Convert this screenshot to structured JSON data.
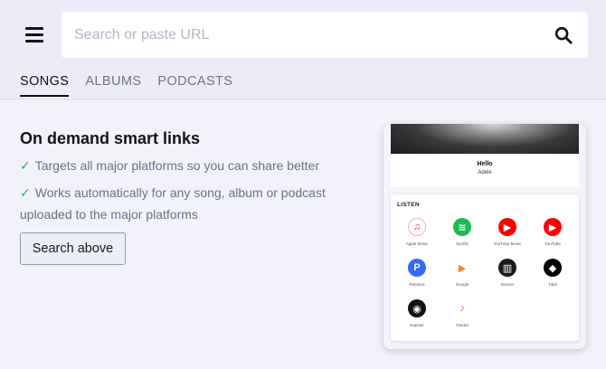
{
  "header": {
    "menu_icon": "hamburger-menu-icon",
    "search": {
      "placeholder": "Search or paste URL",
      "value": "",
      "icon": "search-icon"
    },
    "tabs": [
      {
        "label": "SONGS",
        "active": true
      },
      {
        "label": "ALBUMS",
        "active": false
      },
      {
        "label": "PODCASTS",
        "active": false
      }
    ]
  },
  "main": {
    "headline": "On demand smart links",
    "features": [
      "Targets all major platforms so you can share better",
      "Works automatically for any song, album or podcast uploaded to the major platforms"
    ],
    "check_icon": "check-icon",
    "cta_label": "Search above"
  },
  "preview": {
    "song_title": "Hello",
    "artist": "Adele",
    "listen_label": "LISTEN",
    "services": [
      {
        "name": "Apple Music",
        "icon": "apple-music-icon",
        "color": "#fa2d55"
      },
      {
        "name": "Spotify",
        "icon": "spotify-icon",
        "color": "#1db954"
      },
      {
        "name": "YouTube Music",
        "icon": "youtube-music-icon",
        "color": "#ff0000"
      },
      {
        "name": "YouTube",
        "icon": "youtube-icon",
        "color": "#ff0000"
      },
      {
        "name": "Pandora",
        "icon": "pandora-icon",
        "color": "#3668ff"
      },
      {
        "name": "Google",
        "icon": "google-play-music-icon",
        "color": "#ff8a00"
      },
      {
        "name": "Deezer",
        "icon": "deezer-icon",
        "color": "#1a1a1a"
      },
      {
        "name": "Tidal",
        "icon": "tidal-icon",
        "color": "#000000"
      },
      {
        "name": "Napster",
        "icon": "napster-icon",
        "color": "#111111"
      },
      {
        "name": "Yandex",
        "icon": "yandex-music-icon",
        "color": "#ffcc00"
      }
    ]
  },
  "colors": {
    "accent_green": "#36a65b",
    "background": "#eeeff8"
  }
}
